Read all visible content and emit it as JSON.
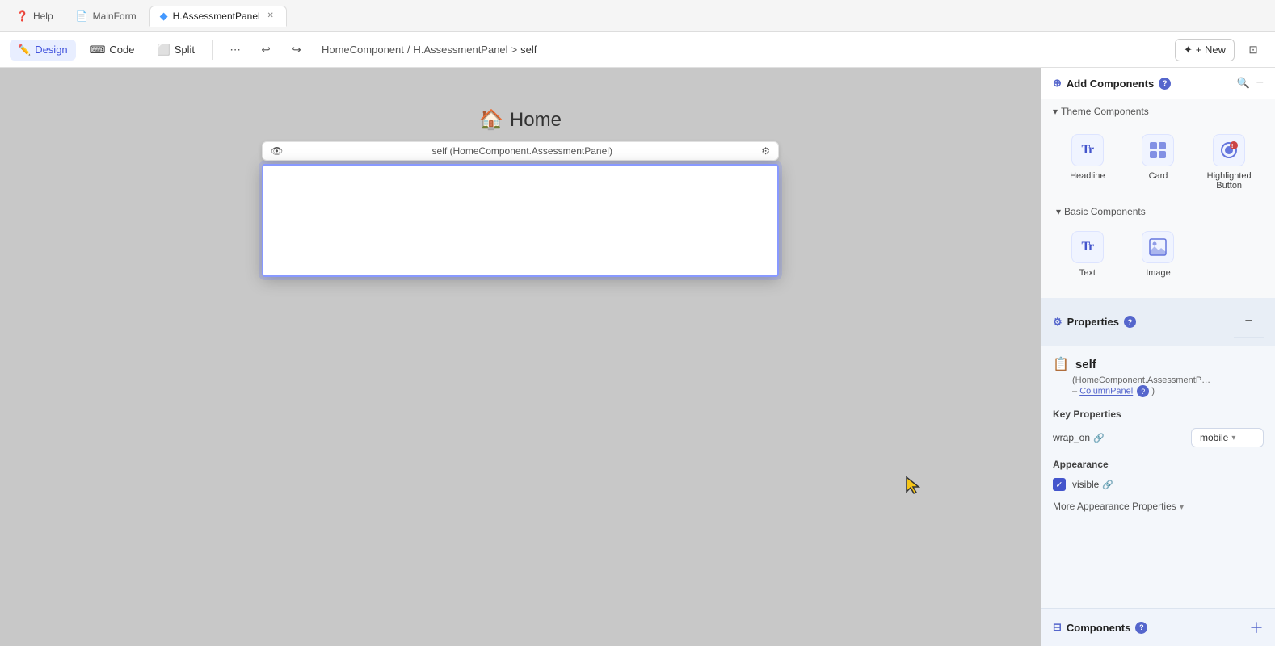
{
  "topbar": {
    "tabs": [
      {
        "id": "help",
        "label": "Help",
        "icon": "❓",
        "active": false,
        "closeable": false
      },
      {
        "id": "mainform",
        "label": "MainForm",
        "icon": "📄",
        "active": false,
        "closeable": false
      },
      {
        "id": "assessmentpanel",
        "label": "H.AssessmentPanel",
        "icon": "🔷",
        "active": true,
        "closeable": true
      }
    ]
  },
  "toolbar": {
    "design_label": "Design",
    "code_label": "Code",
    "split_label": "Split",
    "new_label": "+ New",
    "breadcrumb": {
      "part1": "HomeComponent",
      "sep1": "/",
      "part2": "H.AssessmentPanel",
      "sep2": ">",
      "part3": "self"
    }
  },
  "canvas": {
    "home_label": "Home",
    "component_label": "self (HomeComponent.AssessmentPanel)"
  },
  "right_panel": {
    "add_components": {
      "title": "Add Components",
      "theme_section": {
        "title": "Theme Components",
        "items": [
          {
            "id": "headline",
            "label": "Headline",
            "icon": "Tt"
          },
          {
            "id": "card",
            "label": "Card",
            "icon": "⊞"
          },
          {
            "id": "highlighted_button",
            "label": "Highlighted Button",
            "icon": "🔘"
          }
        ]
      },
      "basic_section": {
        "title": "Basic Components",
        "items": [
          {
            "id": "text",
            "label": "Text",
            "icon": "Tt"
          },
          {
            "id": "image",
            "label": "Image",
            "icon": "🖼"
          }
        ]
      }
    },
    "properties": {
      "title": "Properties",
      "self_name": "self",
      "type_line": "(HomeComponent.AssessmentP... – ColumnPanel",
      "key_properties_label": "Key Properties",
      "wrap_on_label": "wrap_on",
      "wrap_on_value": "mobile",
      "appearance_label": "Appearance",
      "visible_label": "visible",
      "more_appearance_label": "More Appearance Properties"
    },
    "components_bar": {
      "title": "Components",
      "add_tooltip": "Add"
    }
  }
}
